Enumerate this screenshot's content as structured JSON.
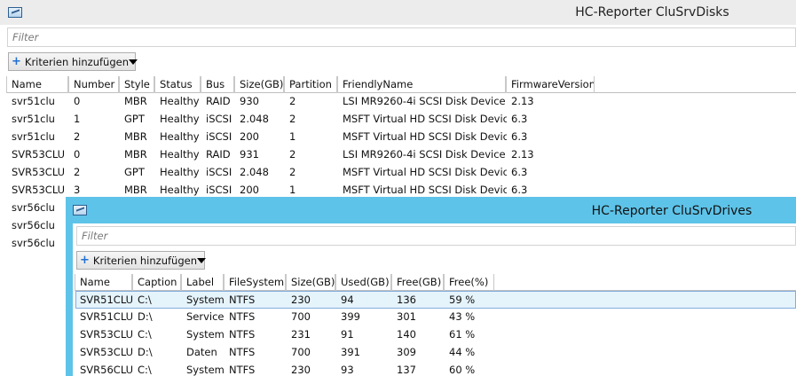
{
  "disks_window": {
    "title": "HC-Reporter CluSrvDisks",
    "filter_placeholder": "Filter",
    "add_criteria_label": "Kriterien hinzufügen",
    "columns": [
      "Name",
      "Number",
      "Style",
      "Status",
      "Bus",
      "Size(GB)",
      "Partition",
      "FriendlyName",
      "FirmwareVersion"
    ],
    "rows": [
      [
        "svr51clu",
        "0",
        "MBR",
        "Healthy",
        "RAID",
        "930",
        "2",
        "LSI MR9260-4i SCSI Disk Device",
        "2.13"
      ],
      [
        "svr51clu",
        "1",
        "GPT",
        "Healthy",
        "iSCSI",
        "2.048",
        "2",
        "MSFT Virtual HD SCSI Disk Device",
        "6.3"
      ],
      [
        "svr51clu",
        "2",
        "MBR",
        "Healthy",
        "iSCSI",
        "200",
        "1",
        "MSFT Virtual HD SCSI Disk Device",
        "6.3"
      ],
      [
        "SVR53CLU",
        "0",
        "MBR",
        "Healthy",
        "RAID",
        "931",
        "2",
        "LSI MR9260-4i SCSI Disk Device",
        "2.13"
      ],
      [
        "SVR53CLU",
        "2",
        "GPT",
        "Healthy",
        "iSCSI",
        "2.048",
        "2",
        "MSFT Virtual HD SCSI Disk Device",
        "6.3"
      ],
      [
        "SVR53CLU",
        "3",
        "MBR",
        "Healthy",
        "iSCSI",
        "200",
        "1",
        "MSFT Virtual HD SCSI Disk Device",
        "6.3"
      ],
      [
        "svr56clu",
        "",
        "",
        "",
        "",
        "",
        "",
        "",
        ""
      ],
      [
        "svr56clu",
        "",
        "",
        "",
        "",
        "",
        "",
        "",
        ""
      ],
      [
        "svr56clu",
        "",
        "",
        "",
        "",
        "",
        "",
        "",
        ""
      ]
    ]
  },
  "drives_window": {
    "title": "HC-Reporter CluSrvDrives",
    "filter_placeholder": "Filter",
    "add_criteria_label": "Kriterien hinzufügen",
    "columns": [
      "Name",
      "Caption",
      "Label",
      "FileSystem",
      "Size(GB)",
      "Used(GB)",
      "Free(GB)",
      "Free(%)"
    ],
    "rows": [
      [
        "SVR51CLU",
        "C:\\",
        "System",
        "NTFS",
        "230",
        "94",
        "136",
        "59 %"
      ],
      [
        "SVR51CLU",
        "D:\\",
        "Service",
        "NTFS",
        "700",
        "399",
        "301",
        "43 %"
      ],
      [
        "SVR53CLU",
        "C:\\",
        "System",
        "NTFS",
        "231",
        "91",
        "140",
        "61 %"
      ],
      [
        "SVR53CLU",
        "D:\\",
        "Daten",
        "NTFS",
        "700",
        "391",
        "309",
        "44 %"
      ],
      [
        "SVR56CLU",
        "C:\\",
        "System",
        "NTFS",
        "230",
        "93",
        "137",
        "60 %"
      ]
    ],
    "selected_row": 0
  },
  "colors": {
    "drives_title_bar": "#5ec3e8",
    "selection_fill": "#e5f3fb",
    "selection_border": "#84acdd",
    "plus_icon": "#1f6fd1"
  },
  "icons": [
    "app-window-icon",
    "plus-icon",
    "caret-down-icon"
  ]
}
